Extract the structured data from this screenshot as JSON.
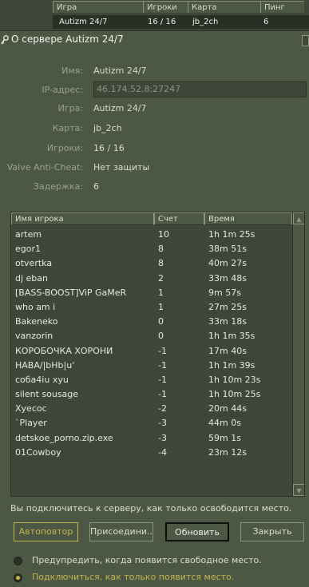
{
  "server_table": {
    "headers": [
      "Игра",
      "Игроки",
      "Карта",
      "Пинг"
    ],
    "row": {
      "game": "Autizm 24/7",
      "players": "16 / 16",
      "map": "jb_2ch",
      "ping": "6"
    }
  },
  "dialog": {
    "title": "О сервере Autizm 24/7",
    "fields": {
      "name_label": "Имя:",
      "name_value": "Autizm 24/7",
      "ip_label": "IP-адрес:",
      "ip_value": "46.174.52.8:27247",
      "game_label": "Игра:",
      "game_value": "Autizm 24/7",
      "map_label": "Карта:",
      "map_value": "jb_2ch",
      "players_label": "Игроки:",
      "players_value": "16 / 16",
      "vac_label": "Valve Anti-Cheat:",
      "vac_value": "Нет защиты",
      "latency_label": "Задержка:",
      "latency_value": "6"
    },
    "player_list": {
      "headers": [
        "Имя игрока",
        "Счет",
        "Время"
      ],
      "players": [
        {
          "name": "artem",
          "score": "10",
          "time": "1h 1m 25s"
        },
        {
          "name": "egor1",
          "score": "8",
          "time": "38m 51s"
        },
        {
          "name": "otvertka",
          "score": "8",
          "time": "40m 27s"
        },
        {
          "name": "dj eban",
          "score": "2",
          "time": "33m 48s"
        },
        {
          "name": "[BASS-BOOST]ViP GaMeR",
          "score": "1",
          "time": "9m 57s"
        },
        {
          "name": "who am i",
          "score": "1",
          "time": "27m 25s"
        },
        {
          "name": "Bakeneko",
          "score": "0",
          "time": "33m 18s"
        },
        {
          "name": "vanzorin",
          "score": "0",
          "time": "1h 1m 35s"
        },
        {
          "name": "КОРОБОЧКА ХОРОНИ",
          "score": "-1",
          "time": "17m 40s"
        },
        {
          "name": "НАВА/|bНb|u'",
          "score": "-1",
          "time": "1h 1m 39s"
        },
        {
          "name": "coбa4iu xyu",
          "score": "-1",
          "time": "1h 10m 23s"
        },
        {
          "name": "silent sousage",
          "score": "-1",
          "time": "1h 10m 25s"
        },
        {
          "name": "Xyecoc",
          "score": "-2",
          "time": "20m 44s"
        },
        {
          "name": "`Player",
          "score": "-3",
          "time": "44m 0s"
        },
        {
          "name": "detskoe_porno.zip.exe",
          "score": "-3",
          "time": "59m 1s"
        },
        {
          "name": "01Cowboy",
          "score": "-4",
          "time": "23m 12s"
        }
      ]
    },
    "notice": "Вы подключитесь к серверу, как только освободится место.",
    "buttons": {
      "autoretry": "Автоповтор",
      "join": "Присоедини...",
      "refresh": "Обновить",
      "close": "Закрыть"
    },
    "options": [
      {
        "label": "Предупредить, когда появится свободное место.",
        "selected": false
      },
      {
        "label": "Подключиться, как только появится место.",
        "selected": true
      }
    ]
  },
  "colors": {
    "background": "#4c5844",
    "accent": "#c4b550",
    "text": "#d8ded3",
    "dim": "#9aa392"
  }
}
